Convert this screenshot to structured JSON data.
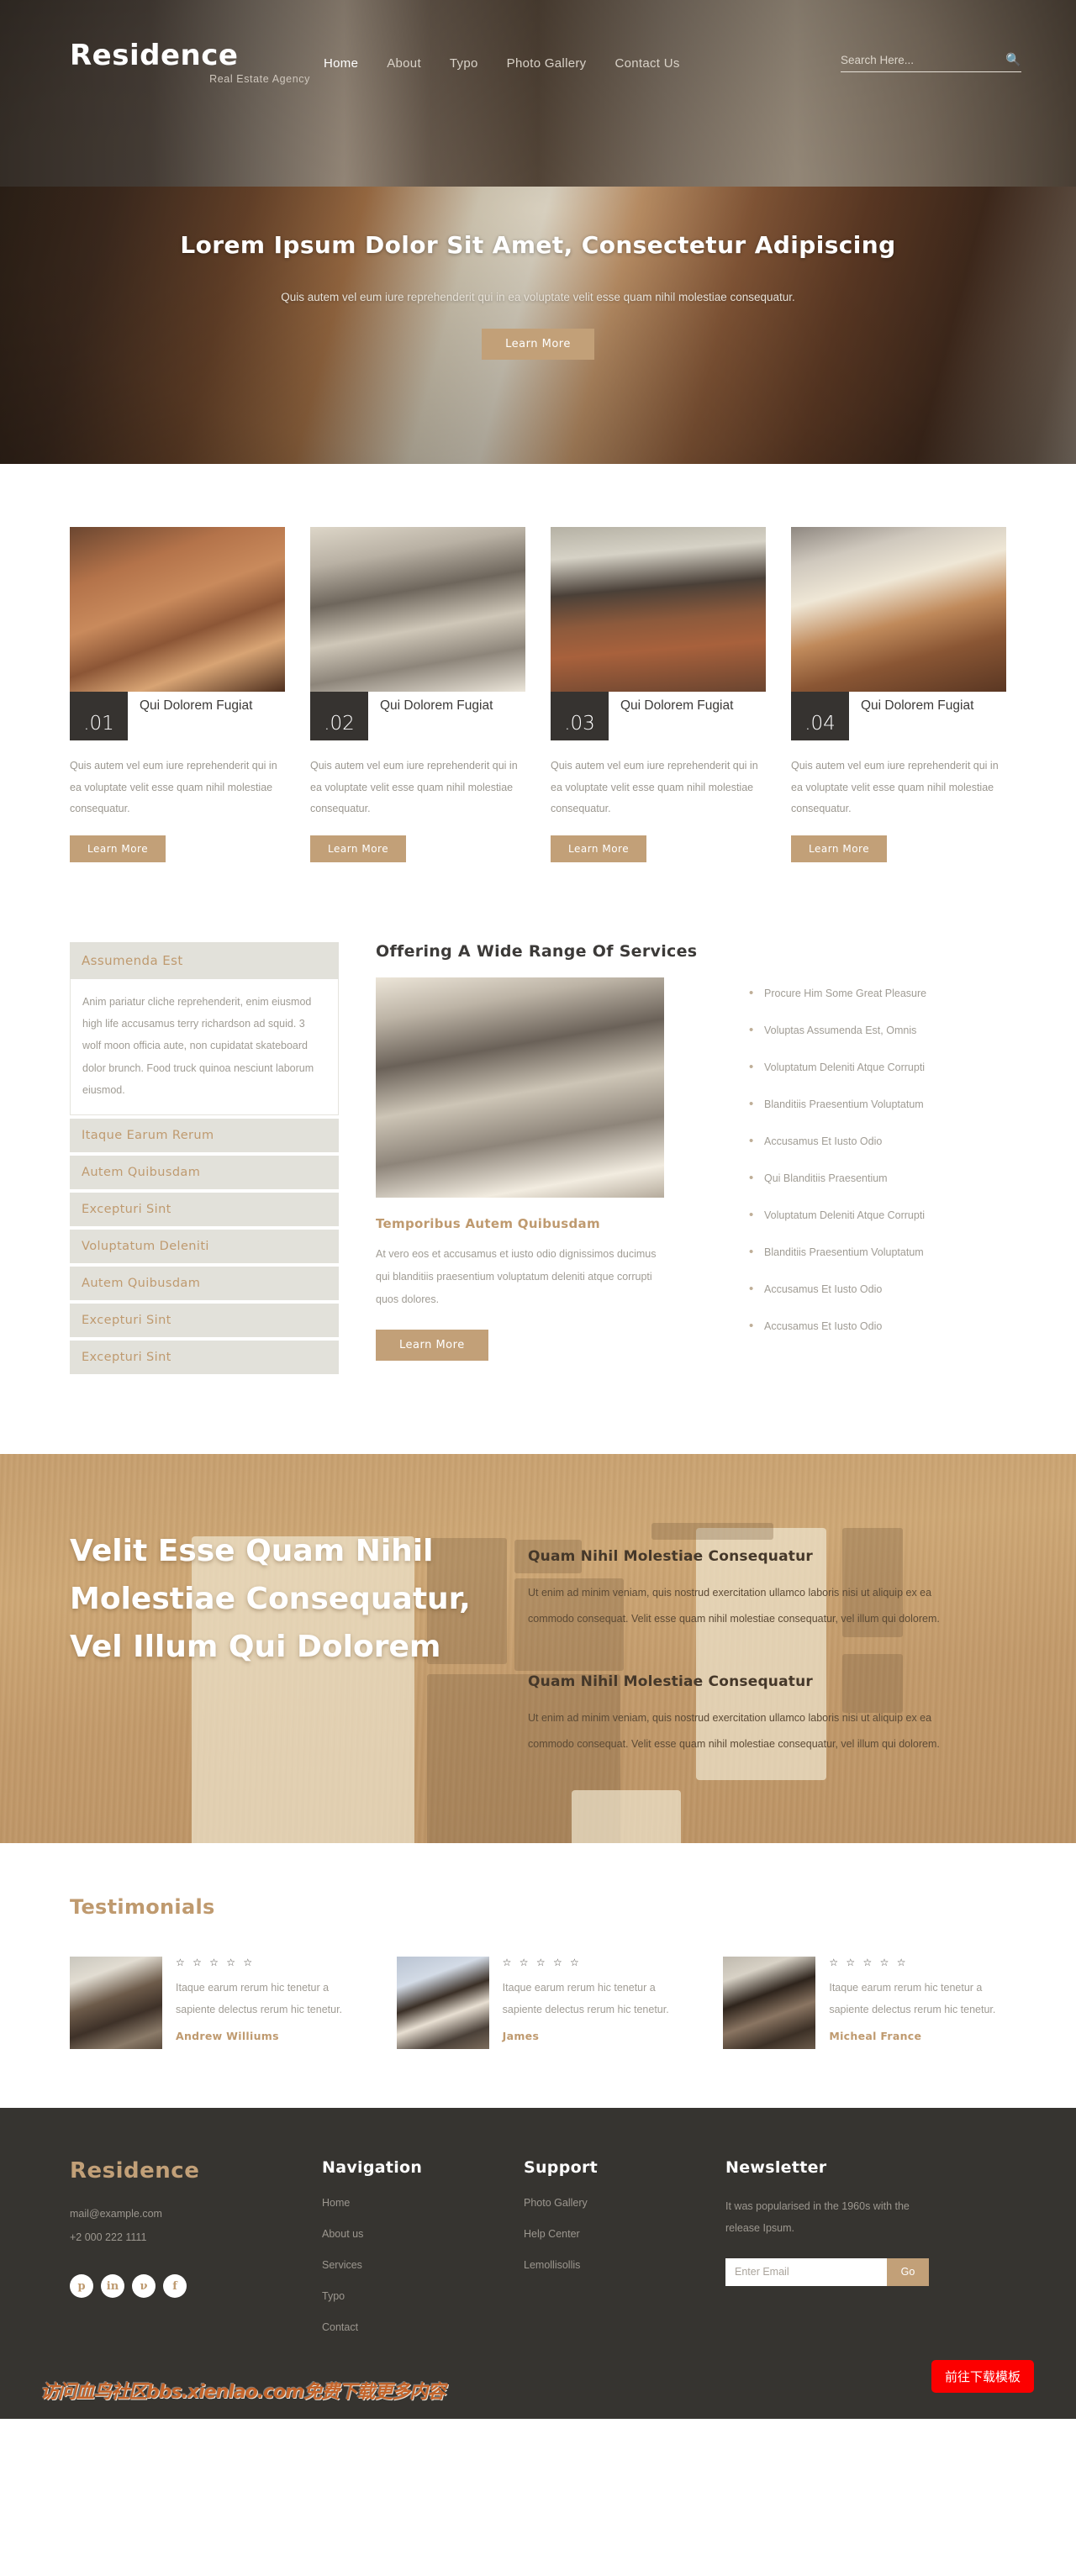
{
  "brand": {
    "name": "Residence",
    "tagline": "Real Estate Agency"
  },
  "nav": {
    "items": [
      {
        "label": "Home",
        "active": true
      },
      {
        "label": "About",
        "active": false
      },
      {
        "label": "Typo",
        "active": false
      },
      {
        "label": "Photo Gallery",
        "active": false
      },
      {
        "label": "Contact Us",
        "active": false
      }
    ]
  },
  "search": {
    "placeholder": "Search Here...",
    "value": "",
    "icon": "search-icon"
  },
  "hero": {
    "title": "Lorem Ipsum Dolor Sit Amet, Consectetur Adipiscing",
    "subtitle": "Quis autem vel eum iure reprehenderit qui in ea voluptate velit esse quam nihil molestiae consequatur.",
    "cta_label": "Learn More"
  },
  "features": {
    "cards": [
      {
        "number": ".01",
        "title": "Qui Dolorem Fugiat",
        "text": "Quis autem vel eum iure reprehenderit qui in ea voluptate velit esse quam nihil molestiae consequatur.",
        "button": "Learn More"
      },
      {
        "number": ".02",
        "title": "Qui Dolorem Fugiat",
        "text": "Quis autem vel eum iure reprehenderit qui in ea voluptate velit esse quam nihil molestiae consequatur.",
        "button": "Learn More"
      },
      {
        "number": ".03",
        "title": "Qui Dolorem Fugiat",
        "text": "Quis autem vel eum iure reprehenderit qui in ea voluptate velit esse quam nihil molestiae consequatur.",
        "button": "Learn More"
      },
      {
        "number": ".04",
        "title": "Qui Dolorem Fugiat",
        "text": "Quis autem vel eum iure reprehenderit qui in ea voluptate velit esse quam nihil molestiae consequatur.",
        "button": "Learn More"
      }
    ]
  },
  "services": {
    "accordion": {
      "open_title": "Assumenda Est",
      "open_body": "Anim pariatur cliche reprehenderit, enim eiusmod high life accusamus terry richardson ad squid. 3 wolf moon officia aute, non cupidatat skateboard dolor brunch. Food truck quinoa nesciunt laborum eiusmod.",
      "items": [
        "Itaque Earum Rerum",
        "Autem Quibusdam",
        "Excepturi Sint",
        "Voluptatum Deleniti",
        "Autem Quibusdam",
        "Excepturi Sint",
        "Excepturi Sint"
      ]
    },
    "title": "Offering A Wide Range Of Services",
    "sub_title": "Temporibus Autem Quibusdam",
    "paragraph": "At vero eos et accusamus et iusto odio dignissimos ducimus qui blanditiis praesentium voluptatum deleniti atque corrupti quos dolores.",
    "button": "Learn More",
    "list": [
      "Procure Him Some Great Pleasure",
      "Voluptas Assumenda Est, Omnis",
      "Voluptatum Deleniti Atque Corrupti",
      "Blanditiis Praesentium Voluptatum",
      "Accusamus Et Iusto Odio",
      "Qui Blanditiis Praesentium",
      "Voluptatum Deleniti Atque Corrupti",
      "Blanditiis Praesentium Voluptatum",
      "Accusamus Et Iusto Odio",
      "Accusamus Et Iusto Odio"
    ]
  },
  "cta": {
    "heading": "Velit Esse Quam Nihil Molestiae Consequatur, Vel Illum Qui Dolorem",
    "blocks": [
      {
        "title": "Quam Nihil Molestiae Consequatur",
        "text": "Ut enim ad minim veniam, quis nostrud exercitation ullamco laboris nisi ut aliquip ex ea commodo consequat. Velit esse quam nihil molestiae consequatur, vel illum qui dolorem."
      },
      {
        "title": "Quam Nihil Molestiae Consequatur",
        "text": "Ut enim ad minim veniam, quis nostrud exercitation ullamco laboris nisi ut aliquip ex ea commodo consequat. Velit esse quam nihil molestiae consequatur, vel illum qui dolorem."
      }
    ]
  },
  "testimonials": {
    "heading": "Testimonials",
    "stars": "☆ ☆ ☆ ☆ ☆",
    "items": [
      {
        "text": "Itaque earum rerum hic tenetur a sapiente delectus rerum hic tenetur.",
        "name": "Andrew Williums"
      },
      {
        "text": "Itaque earum rerum hic tenetur a sapiente delectus rerum hic tenetur.",
        "name": "James"
      },
      {
        "text": "Itaque earum rerum hic tenetur a sapiente delectus rerum hic tenetur.",
        "name": "Micheal France"
      }
    ]
  },
  "footer": {
    "logo": "Residence",
    "email": "mail@example.com",
    "phone": "+2 000 222 1111",
    "socials": [
      {
        "name": "pinterest-icon",
        "glyph": "p"
      },
      {
        "name": "linkedin-icon",
        "glyph": "in"
      },
      {
        "name": "vimeo-icon",
        "glyph": "ν"
      },
      {
        "name": "facebook-icon",
        "glyph": "f"
      }
    ],
    "navigation": {
      "heading": "Navigation",
      "links": [
        "Home",
        "About us",
        "Services",
        "Typo",
        "Contact"
      ]
    },
    "support": {
      "heading": "Support",
      "links": [
        "Photo Gallery",
        "Help Center",
        "Lemollisollis"
      ]
    },
    "newsletter": {
      "heading": "Newsletter",
      "text": "It was popularised in the 1960s with the release Ipsum.",
      "input_placeholder": "Enter Email",
      "input_value": "",
      "button": "Go"
    },
    "download_button": "前往下载模板",
    "watermark": "访问血鸟社区bbs.xienlao.com免费下载更多内容"
  },
  "colors": {
    "accent": "#c2a078",
    "dark": "#363430",
    "tan_band": "#c8a071",
    "red_button": "#fc0000"
  }
}
